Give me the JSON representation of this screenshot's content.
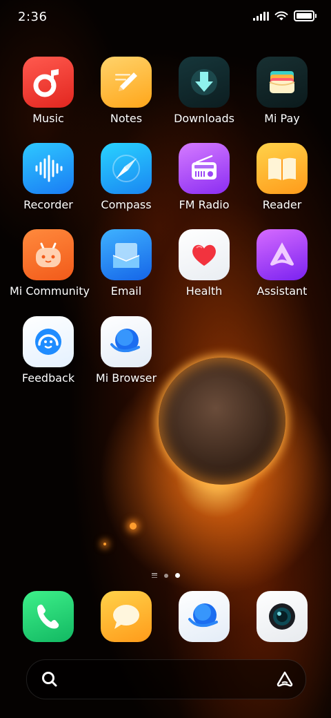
{
  "status_bar": {
    "time": "2:36"
  },
  "apps": [
    {
      "label": "Music"
    },
    {
      "label": "Notes"
    },
    {
      "label": "Downloads"
    },
    {
      "label": "Mi Pay"
    },
    {
      "label": "Recorder"
    },
    {
      "label": "Compass"
    },
    {
      "label": "FM Radio"
    },
    {
      "label": "Reader"
    },
    {
      "label": "Mi Community"
    },
    {
      "label": "Email"
    },
    {
      "label": "Health"
    },
    {
      "label": "Assistant"
    },
    {
      "label": "Feedback"
    },
    {
      "label": "Mi Browser"
    }
  ],
  "page_indicator": {
    "pages": 2,
    "current": 2
  },
  "dock": [
    "phone-icon",
    "messages-icon",
    "browser-icon",
    "camera-icon"
  ],
  "search": {
    "icon": "search-icon",
    "right_icon": "assistant-icon"
  }
}
